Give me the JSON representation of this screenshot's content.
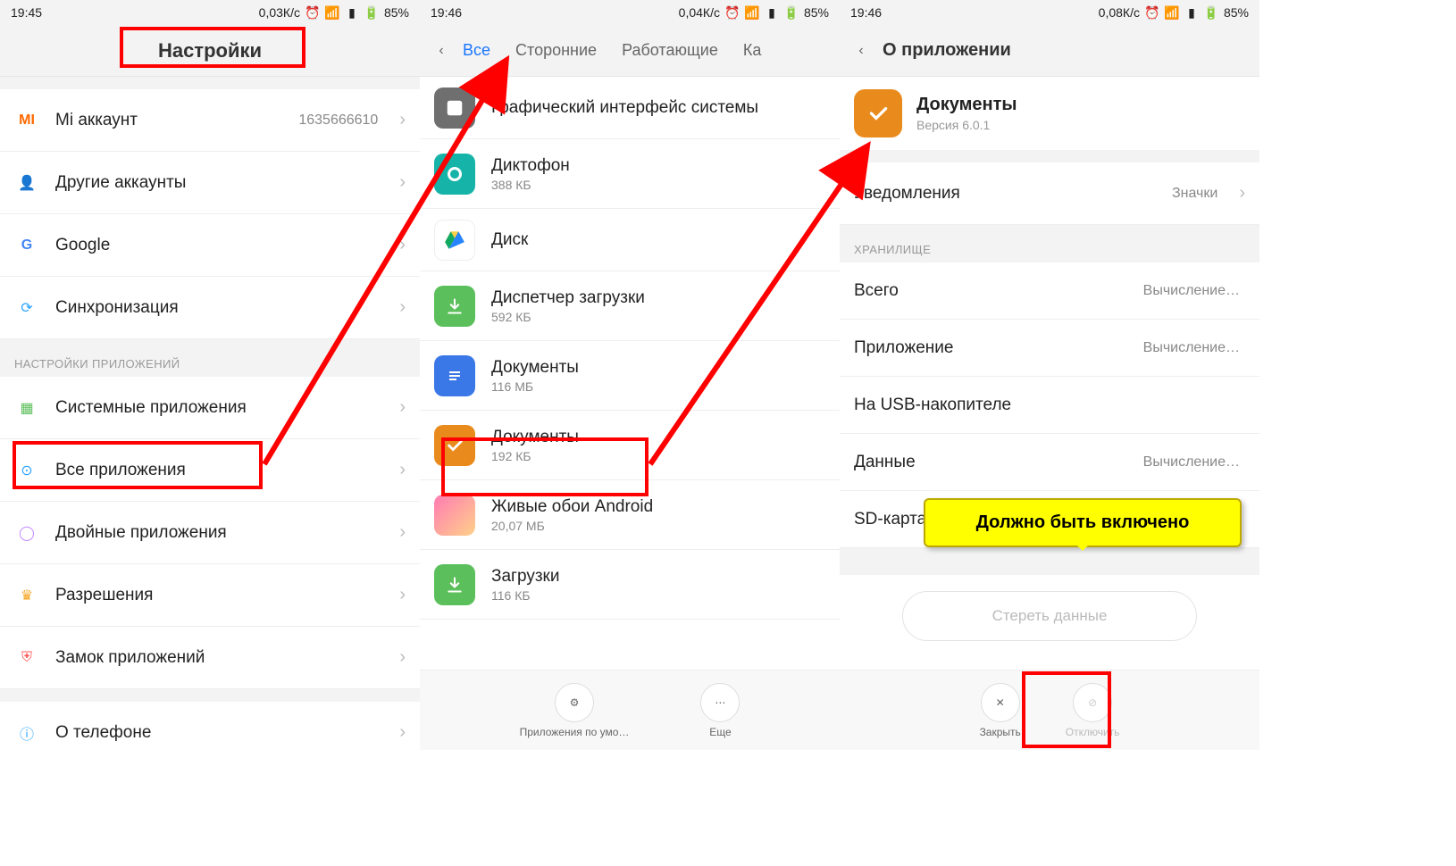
{
  "screen1": {
    "status": {
      "time": "19:45",
      "speed": "0,03К/с",
      "battery": "85%"
    },
    "title": "Настройки",
    "rows": {
      "mi": {
        "label": "Mi аккаунт",
        "value": "1635666610"
      },
      "other": {
        "label": "Другие аккаунты"
      },
      "google": {
        "label": "Google"
      },
      "sync": {
        "label": "Синхронизация"
      }
    },
    "section_apps": "НАСТРОЙКИ ПРИЛОЖЕНИЙ",
    "rows2": {
      "sys": {
        "label": "Системные приложения"
      },
      "all": {
        "label": "Все приложения"
      },
      "dual": {
        "label": "Двойные приложения"
      },
      "perm": {
        "label": "Разрешения"
      },
      "lock": {
        "label": "Замок приложений"
      },
      "about": {
        "label": "О телефоне"
      }
    }
  },
  "screen2": {
    "status": {
      "time": "19:46",
      "speed": "0,04К/с",
      "battery": "85%"
    },
    "tabs": {
      "all": "Все",
      "third": "Сторонние",
      "run": "Работающие",
      "more": "Ка"
    },
    "apps": {
      "sysui": {
        "name": "Графический интерфейс системы"
      },
      "rec": {
        "name": "Диктофон",
        "size": "388 КБ"
      },
      "drive": {
        "name": "Диск"
      },
      "dlmgr": {
        "name": "Диспетчер загрузки",
        "size": "592 КБ"
      },
      "gdocs": {
        "name": "Документы",
        "size": "116 МБ"
      },
      "docs": {
        "name": "Документы",
        "size": "192 КБ"
      },
      "lwall": {
        "name": "Живые обои Android",
        "size": "20,07 МБ"
      },
      "dl": {
        "name": "Загрузки",
        "size": "116 КБ"
      }
    },
    "bottom": {
      "default": "Приложения по умо…",
      "more": "Еще"
    }
  },
  "screen3": {
    "status": {
      "time": "19:46",
      "speed": "0,08К/с",
      "battery": "85%"
    },
    "title": "О приложении",
    "app": {
      "name": "Документы",
      "version": "Версия 6.0.1"
    },
    "notif": {
      "label": "Уведомления",
      "value": "Значки"
    },
    "section_storage": "ХРАНИЛИЩЕ",
    "storage": {
      "total": {
        "label": "Всего",
        "value": "Вычисление…"
      },
      "app": {
        "label": "Приложение",
        "value": "Вычисление…"
      },
      "usb": {
        "label": "На USB-накопителе"
      },
      "data": {
        "label": "Данные",
        "value": "Вычисление…"
      },
      "sd": {
        "label": "SD-карта"
      }
    },
    "clear_btn": "Стереть данные",
    "bottom": {
      "close": "Закрыть",
      "disable": "Отключить"
    }
  },
  "callout": "Должно быть включено"
}
